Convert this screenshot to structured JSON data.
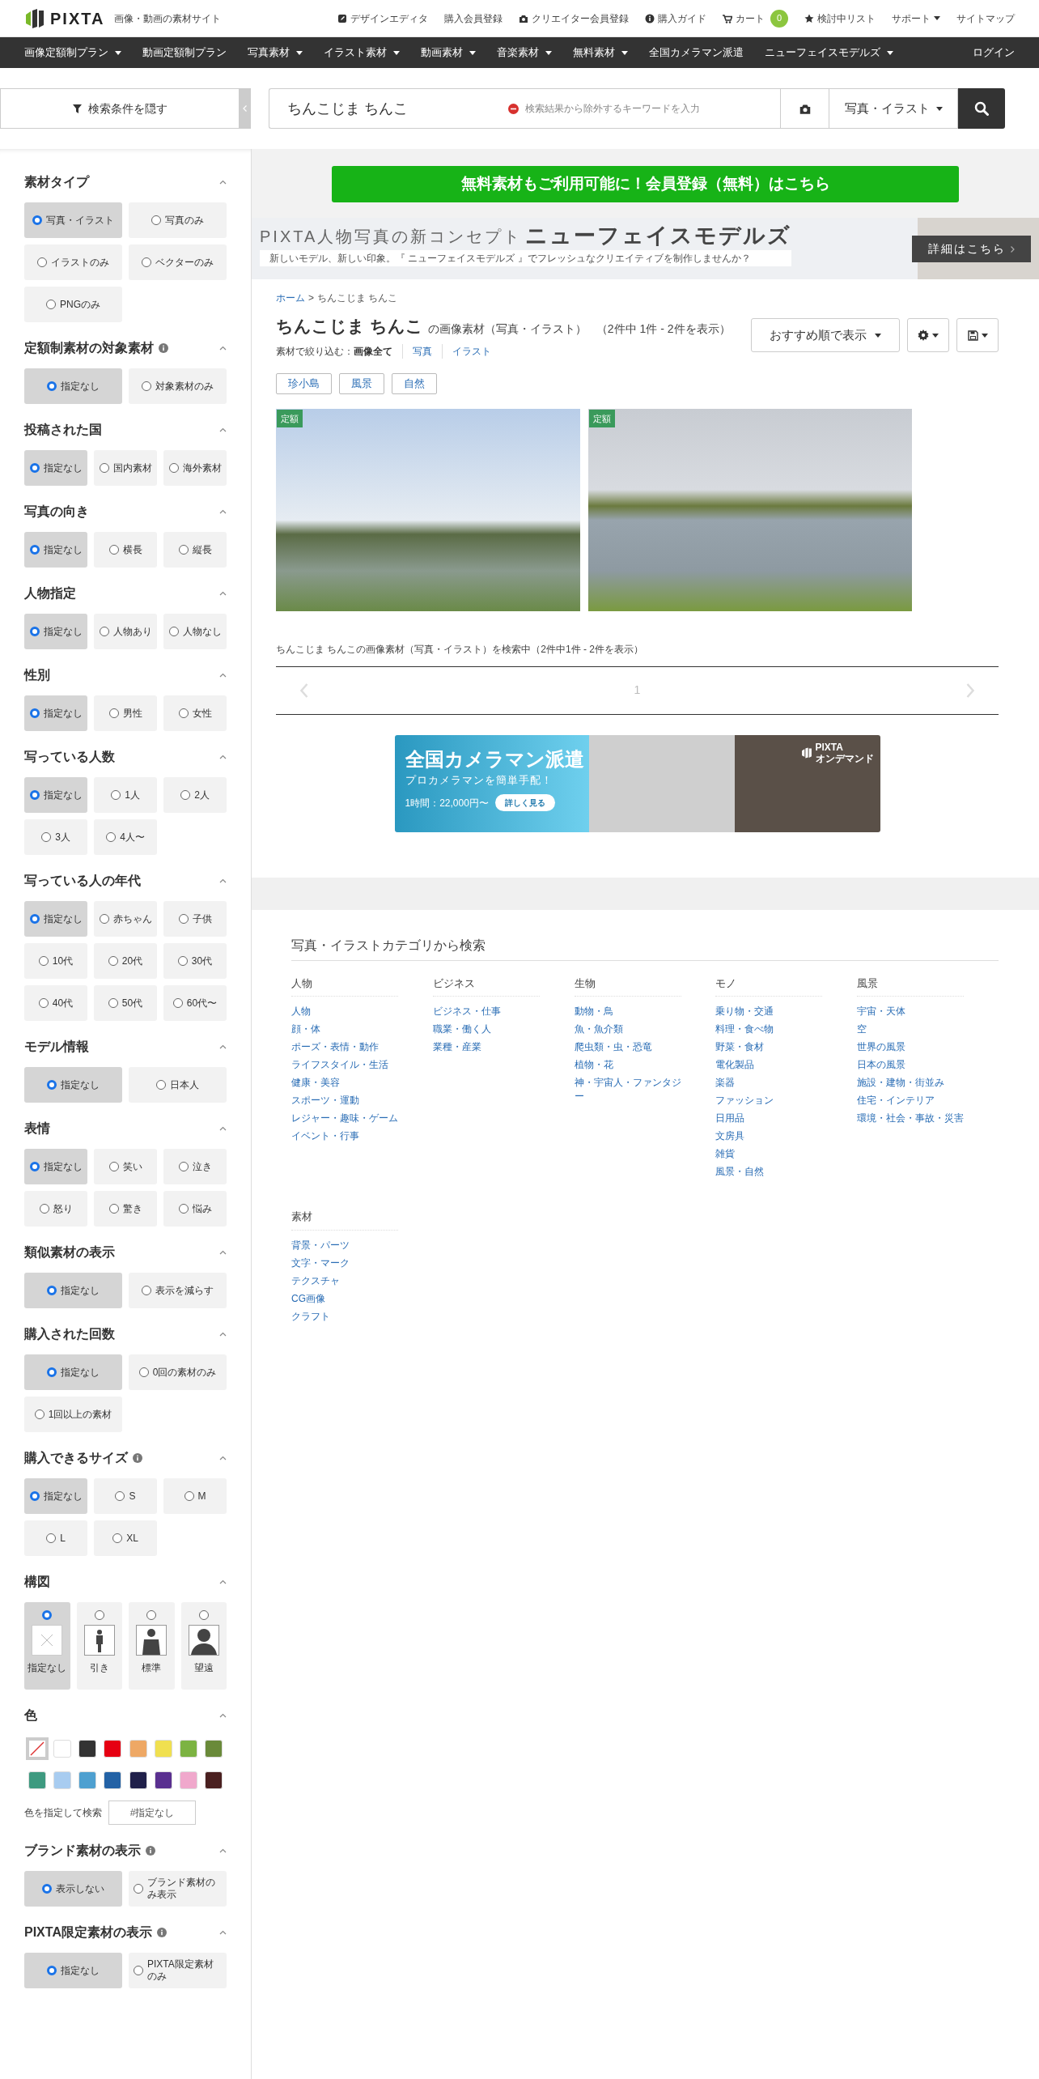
{
  "header": {
    "logo": "PIXTA",
    "tagline": "画像・動画の素材サイト",
    "links": [
      {
        "label": "デザインエディタ",
        "kind": "pencil"
      },
      {
        "label": "購入会員登録",
        "kind": "plain"
      },
      {
        "label": "クリエイター会員登録",
        "kind": "camera"
      },
      {
        "label": "購入ガイド",
        "kind": "info"
      },
      {
        "label": "カート",
        "kind": "cart",
        "badge": "0"
      },
      {
        "label": "検討中リスト",
        "kind": "star"
      },
      {
        "label": "サポート",
        "kind": "dropdown"
      },
      {
        "label": "サイトマップ",
        "kind": "plain"
      }
    ]
  },
  "nav": {
    "items": [
      {
        "label": "画像定額制プラン",
        "dropdown": true
      },
      {
        "label": "動画定額制プラン",
        "dropdown": false
      },
      {
        "label": "写真素材",
        "dropdown": true
      },
      {
        "label": "イラスト素材",
        "dropdown": true
      },
      {
        "label": "動画素材",
        "dropdown": true
      },
      {
        "label": "音楽素材",
        "dropdown": true
      },
      {
        "label": "無料素材",
        "dropdown": true
      },
      {
        "label": "全国カメラマン派遣",
        "dropdown": false
      },
      {
        "label": "ニューフェイスモデルズ",
        "dropdown": true
      }
    ],
    "login": "ログイン"
  },
  "search": {
    "toggle_label": "検索条件を隠す",
    "query": "ちんこじま ちんこ",
    "exclude_placeholder": "検索結果から除外するキーワードを入力",
    "type": "写真・イラスト"
  },
  "sidebar": [
    {
      "title": "素材タイプ",
      "info": false,
      "expanded": true,
      "kind": "pairs",
      "options": [
        {
          "label": "写真・イラスト",
          "selected": true
        },
        {
          "label": "写真のみ",
          "selected": false
        },
        {
          "label": "イラストのみ",
          "selected": false
        },
        {
          "label": "ベクターのみ",
          "selected": false
        },
        {
          "label": "PNGのみ",
          "selected": false
        }
      ]
    },
    {
      "title": "定額制素材の対象素材",
      "info": true,
      "expanded": true,
      "kind": "pairs",
      "options": [
        {
          "label": "指定なし",
          "selected": true
        },
        {
          "label": "対象素材のみ",
          "selected": false
        }
      ]
    },
    {
      "title": "投稿された国",
      "info": false,
      "expanded": true,
      "kind": "triples",
      "options": [
        {
          "label": "指定なし",
          "selected": true
        },
        {
          "label": "国内素材",
          "selected": false
        },
        {
          "label": "海外素材",
          "selected": false
        }
      ]
    },
    {
      "title": "写真の向き",
      "info": false,
      "expanded": true,
      "kind": "triples",
      "options": [
        {
          "label": "指定なし",
          "selected": true
        },
        {
          "label": "横長",
          "selected": false
        },
        {
          "label": "縦長",
          "selected": false
        }
      ]
    },
    {
      "title": "人物指定",
      "info": false,
      "expanded": true,
      "kind": "triples",
      "options": [
        {
          "label": "指定なし",
          "selected": true
        },
        {
          "label": "人物あり",
          "selected": false
        },
        {
          "label": "人物なし",
          "selected": false
        }
      ]
    },
    {
      "title": "性別",
      "info": false,
      "expanded": true,
      "kind": "triples",
      "options": [
        {
          "label": "指定なし",
          "selected": true
        },
        {
          "label": "男性",
          "selected": false
        },
        {
          "label": "女性",
          "selected": false
        }
      ]
    },
    {
      "title": "写っている人数",
      "info": false,
      "expanded": true,
      "kind": "triples",
      "options": [
        {
          "label": "指定なし",
          "selected": true
        },
        {
          "label": "1人",
          "selected": false
        },
        {
          "label": "2人",
          "selected": false
        },
        {
          "label": "3人",
          "selected": false
        },
        {
          "label": "4人〜",
          "selected": false
        }
      ]
    },
    {
      "title": "写っている人の年代",
      "info": false,
      "expanded": true,
      "kind": "triples",
      "options": [
        {
          "label": "指定なし",
          "selected": true
        },
        {
          "label": "赤ちゃん",
          "selected": false
        },
        {
          "label": "子供",
          "selected": false
        },
        {
          "label": "10代",
          "selected": false
        },
        {
          "label": "20代",
          "selected": false
        },
        {
          "label": "30代",
          "selected": false
        },
        {
          "label": "40代",
          "selected": false
        },
        {
          "label": "50代",
          "selected": false
        },
        {
          "label": "60代〜",
          "selected": false
        }
      ]
    },
    {
      "title": "モデル情報",
      "info": false,
      "expanded": true,
      "kind": "pairs",
      "options": [
        {
          "label": "指定なし",
          "selected": true
        },
        {
          "label": "日本人",
          "selected": false
        }
      ]
    },
    {
      "title": "表情",
      "info": false,
      "expanded": true,
      "kind": "triples",
      "options": [
        {
          "label": "指定なし",
          "selected": true
        },
        {
          "label": "笑い",
          "selected": false
        },
        {
          "label": "泣き",
          "selected": false
        },
        {
          "label": "怒り",
          "selected": false
        },
        {
          "label": "驚き",
          "selected": false
        },
        {
          "label": "悩み",
          "selected": false
        }
      ]
    },
    {
      "title": "類似素材の表示",
      "info": false,
      "expanded": true,
      "kind": "pairs",
      "options": [
        {
          "label": "指定なし",
          "selected": true
        },
        {
          "label": "表示を減らす",
          "selected": false
        }
      ]
    },
    {
      "title": "購入された回数",
      "info": false,
      "expanded": true,
      "kind": "pairs",
      "options": [
        {
          "label": "指定なし",
          "selected": true
        },
        {
          "label": "0回の素材のみ",
          "selected": false
        },
        {
          "label": "1回以上の素材",
          "selected": false
        }
      ]
    },
    {
      "title": "購入できるサイズ",
      "info": true,
      "expanded": true,
      "kind": "triples",
      "options": [
        {
          "label": "指定なし",
          "selected": true
        },
        {
          "label": "S",
          "selected": false
        },
        {
          "label": "M",
          "selected": false
        },
        {
          "label": "L",
          "selected": false
        },
        {
          "label": "XL",
          "selected": false
        }
      ]
    },
    {
      "title": "構図",
      "info": false,
      "expanded": true,
      "kind": "composition",
      "options": [
        {
          "label": "指定なし",
          "selected": true,
          "kind": "none"
        },
        {
          "label": "引き",
          "selected": false,
          "kind": "full"
        },
        {
          "label": "標準",
          "selected": false,
          "kind": "medium"
        },
        {
          "label": "望遠",
          "selected": false,
          "kind": "close"
        }
      ]
    },
    {
      "title": "色",
      "info": false,
      "expanded": true,
      "kind": "colors",
      "swatches": [
        {
          "kind": "none",
          "selected": true
        },
        {
          "kind": "color",
          "color": "#ffffff",
          "selected": false
        },
        {
          "kind": "color",
          "color": "#333333",
          "selected": false
        },
        {
          "kind": "color",
          "color": "#e60012",
          "selected": false
        },
        {
          "kind": "color",
          "color": "#eea865",
          "selected": false
        },
        {
          "kind": "color",
          "color": "#f0e050",
          "selected": false
        },
        {
          "kind": "color",
          "color": "#7cb342",
          "selected": false
        },
        {
          "kind": "color",
          "color": "#6a8a3a",
          "selected": false
        },
        {
          "kind": "color",
          "color": "#3e9a80",
          "selected": false
        },
        {
          "kind": "color",
          "color": "#a8ccf0",
          "selected": false
        },
        {
          "kind": "color",
          "color": "#4ea0d0",
          "selected": false
        },
        {
          "kind": "color",
          "color": "#2362a5",
          "selected": false
        },
        {
          "kind": "color",
          "color": "#20204a",
          "selected": false
        },
        {
          "kind": "color",
          "color": "#5a3090",
          "selected": false
        },
        {
          "kind": "color",
          "color": "#f0a8cc",
          "selected": false
        },
        {
          "kind": "color",
          "color": "#4a2020",
          "selected": false
        }
      ],
      "search_label": "色を指定して検索",
      "search_placeholder": "#指定なし"
    },
    {
      "title": "ブランド素材の表示",
      "info": true,
      "expanded": true,
      "kind": "pairs",
      "options": [
        {
          "label": "表示しない",
          "selected": true
        },
        {
          "label": "ブランド素材のみ表示",
          "selected": false
        }
      ]
    },
    {
      "title": "PIXTA限定素材の表示",
      "info": true,
      "expanded": true,
      "kind": "pairs",
      "options": [
        {
          "label": "指定なし",
          "selected": true
        },
        {
          "label": "PIXTA限定素材のみ",
          "selected": false
        }
      ]
    }
  ],
  "promo": {
    "register": "無料素材もご利用可能に！会員登録（無料）はこちら",
    "banner": {
      "heading": "PIXTA人物写真の新コンセプト",
      "title": "ニューフェイスモデルズ",
      "subtitle": "新しいモデル、新しい印象。『 ニューフェイスモデルズ 』でフレッシュなクリエイティブを制作しませんか？",
      "button": "詳細はこちら"
    }
  },
  "breadcrumb": {
    "items": [
      {
        "label": "ホーム",
        "link": true
      },
      {
        "label": "ちんこじま ちんこ",
        "link": false
      }
    ],
    "separator": ">"
  },
  "heading": {
    "query": "ちんこじま ちんこ",
    "suffix": "の画像素材（写真・イラスト）",
    "count": "（2件中 1件 - 2件を表示）"
  },
  "filter": {
    "label": "素材で絞り込む：",
    "options": [
      {
        "label": "画像全て",
        "selected": true
      },
      {
        "label": "写真",
        "selected": false
      },
      {
        "label": "イラスト",
        "selected": false
      }
    ]
  },
  "sort": "おすすめ順で表示",
  "tags": [
    "珍小島",
    "風景",
    "自然"
  ],
  "results": [
    {
      "badge": "定額",
      "kind": "sky"
    },
    {
      "badge": "定額",
      "kind": "shore"
    }
  ],
  "summary": "ちんこじま ちんこの画像素材（写真・イラスト）を検索中（2件中1件 - 2件を表示）",
  "pagination": {
    "pages": [
      {
        "label": "1",
        "selected": true
      }
    ]
  },
  "ad": {
    "title": "全国カメラマン派遣",
    "subtitle": "プロカメラマンを簡単手配！",
    "price": "1時間：22,000円〜",
    "button": "詳しく見る",
    "brand": "PIXTA",
    "brand_sub": "オンデマンド"
  },
  "categories": {
    "title": "写真・イラストカテゴリから検索",
    "groups": [
      {
        "heading": "人物",
        "links": [
          "人物",
          "顔・体",
          "ポーズ・表情・動作",
          "ライフスタイル・生活",
          "健康・美容",
          "スポーツ・運動",
          "レジャー・趣味・ゲーム",
          "イベント・行事"
        ]
      },
      {
        "heading": "ビジネス",
        "links": [
          "ビジネス・仕事",
          "職業・働く人",
          "業種・産業"
        ]
      },
      {
        "heading": "生物",
        "links": [
          "動物・鳥",
          "魚・魚介類",
          "爬虫類・虫・恐竜",
          "植物・花",
          "神・宇宙人・ファンタジー"
        ]
      },
      {
        "heading": "モノ",
        "links": [
          "乗り物・交通",
          "料理・食べ物",
          "野菜・食材",
          "電化製品",
          "楽器",
          "ファッション",
          "日用品",
          "文房具",
          "雑貨",
          "風景・自然"
        ]
      },
      {
        "heading": "風景",
        "links": [
          "宇宙・天体",
          "空",
          "世界の風景",
          "日本の風景",
          "施設・建物・街並み",
          "住宅・インテリア",
          "環境・社会・事故・災害"
        ]
      },
      {
        "heading": "素材",
        "links": [
          "背景・パーツ",
          "文字・マーク",
          "テクスチャ",
          "CG画像",
          "クラフト"
        ]
      }
    ]
  }
}
